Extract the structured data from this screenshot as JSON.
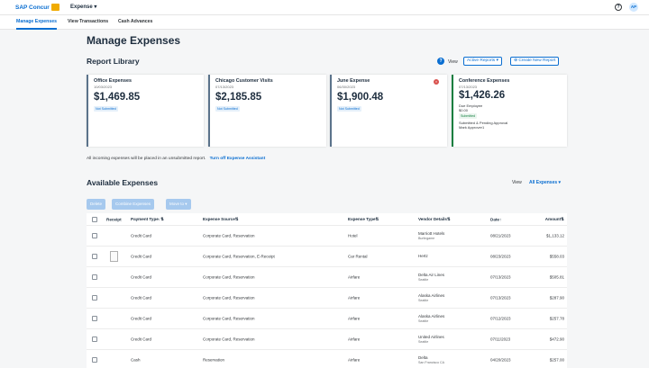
{
  "topbar": {
    "brand": "SAP Concur",
    "menu": "Expense",
    "menu_caret": "▾",
    "help_icon": "?",
    "avatar_initials": "AP"
  },
  "subnav": {
    "items": [
      "Manage Expenses",
      "View Transactions",
      "Cash Advances"
    ]
  },
  "page_title": "Manage Expenses",
  "report_library": {
    "title": "Report Library",
    "view_label": "View",
    "view_value": "Active Reports ▾",
    "create_button": "⊕ Create New Report",
    "info_icon": "?",
    "delete_icon": "×",
    "cards": [
      {
        "title": "Office Expenses",
        "date": "10/03/2023",
        "amount": "$1,469.85",
        "status": "Not Submitted"
      },
      {
        "title": "Chicago Customer Visits",
        "date": "07/13/2023",
        "amount": "$2,185.85",
        "status": "Not Submitted"
      },
      {
        "title": "June Expense",
        "date": "06/30/2023",
        "amount": "$1,900.48",
        "status": "Not Submitted"
      },
      {
        "title": "Conference Expenses",
        "date": "07/13/2023",
        "amount": "$1,426.26",
        "owed_label": "Due Employee",
        "owed_amount": "$0.00",
        "status": "Submitted",
        "approval": "Submitted & Pending Approval",
        "approver": "Mark Approver1"
      }
    ]
  },
  "footer_note": {
    "text": "All incoming expenses will be placed in an unsubmitted report.",
    "link": "Turn off Expense Assistant"
  },
  "available_expenses": {
    "title": "Available Expenses",
    "view_label": "View",
    "view_value": "All Expenses ▾",
    "actions": [
      "Delete",
      "Combine Expenses",
      "Move to ▾"
    ],
    "columns": [
      "Receipt",
      "Payment Type↓⇅",
      "Expense Source⇅",
      "Expense Type⇅",
      "Vendor Details⇅",
      "Date↑",
      "Amount⇅"
    ],
    "rows": [
      {
        "payment": "Credit Card",
        "source": "Corporate Card, Reservation",
        "type": "Hotel",
        "vendor": "Marriott Hotels",
        "location": "Burlingame",
        "date": "08/21/2023",
        "amount": "$1,133.12",
        "receipt": false
      },
      {
        "payment": "Credit Card",
        "source": "Corporate Card, Reservation, E-Receipt",
        "type": "Car Rental",
        "vendor": "Hertz",
        "location": "",
        "date": "08/23/2023",
        "amount": "$558.03",
        "receipt": true
      },
      {
        "payment": "Credit Card",
        "source": "Corporate Card, Reservation",
        "type": "Airfare",
        "vendor": "Delta Air Lines",
        "location": "Seattle",
        "date": "07/13/2023",
        "amount": "$505.81",
        "receipt": false
      },
      {
        "payment": "Credit Card",
        "source": "Corporate Card, Reservation",
        "type": "Airfare",
        "vendor": "Alaska Airlines",
        "location": "Seattle",
        "date": "07/13/2023",
        "amount": "$287.90",
        "receipt": false
      },
      {
        "payment": "Credit Card",
        "source": "Corporate Card, Reservation",
        "type": "Airfare",
        "vendor": "Alaska Airlines",
        "location": "Seattle",
        "date": "07/12/2023",
        "amount": "$257.78",
        "receipt": false
      },
      {
        "payment": "Credit Card",
        "source": "Corporate Card, Reservation",
        "type": "Airfare",
        "vendor": "United Airlines",
        "location": "Seattle",
        "date": "07/11/2023",
        "amount": "$472.90",
        "receipt": false
      },
      {
        "payment": "Cash",
        "source": "Reservation",
        "type": "Airfare",
        "vendor": "Delta",
        "location": "San Francisco CA",
        "date": "04/20/2023",
        "amount": "$257.00",
        "receipt": false
      }
    ]
  },
  "colors": {
    "accent": "#0a6ed1",
    "status_green": "#107e3e",
    "delete_red": "#d9534f"
  }
}
